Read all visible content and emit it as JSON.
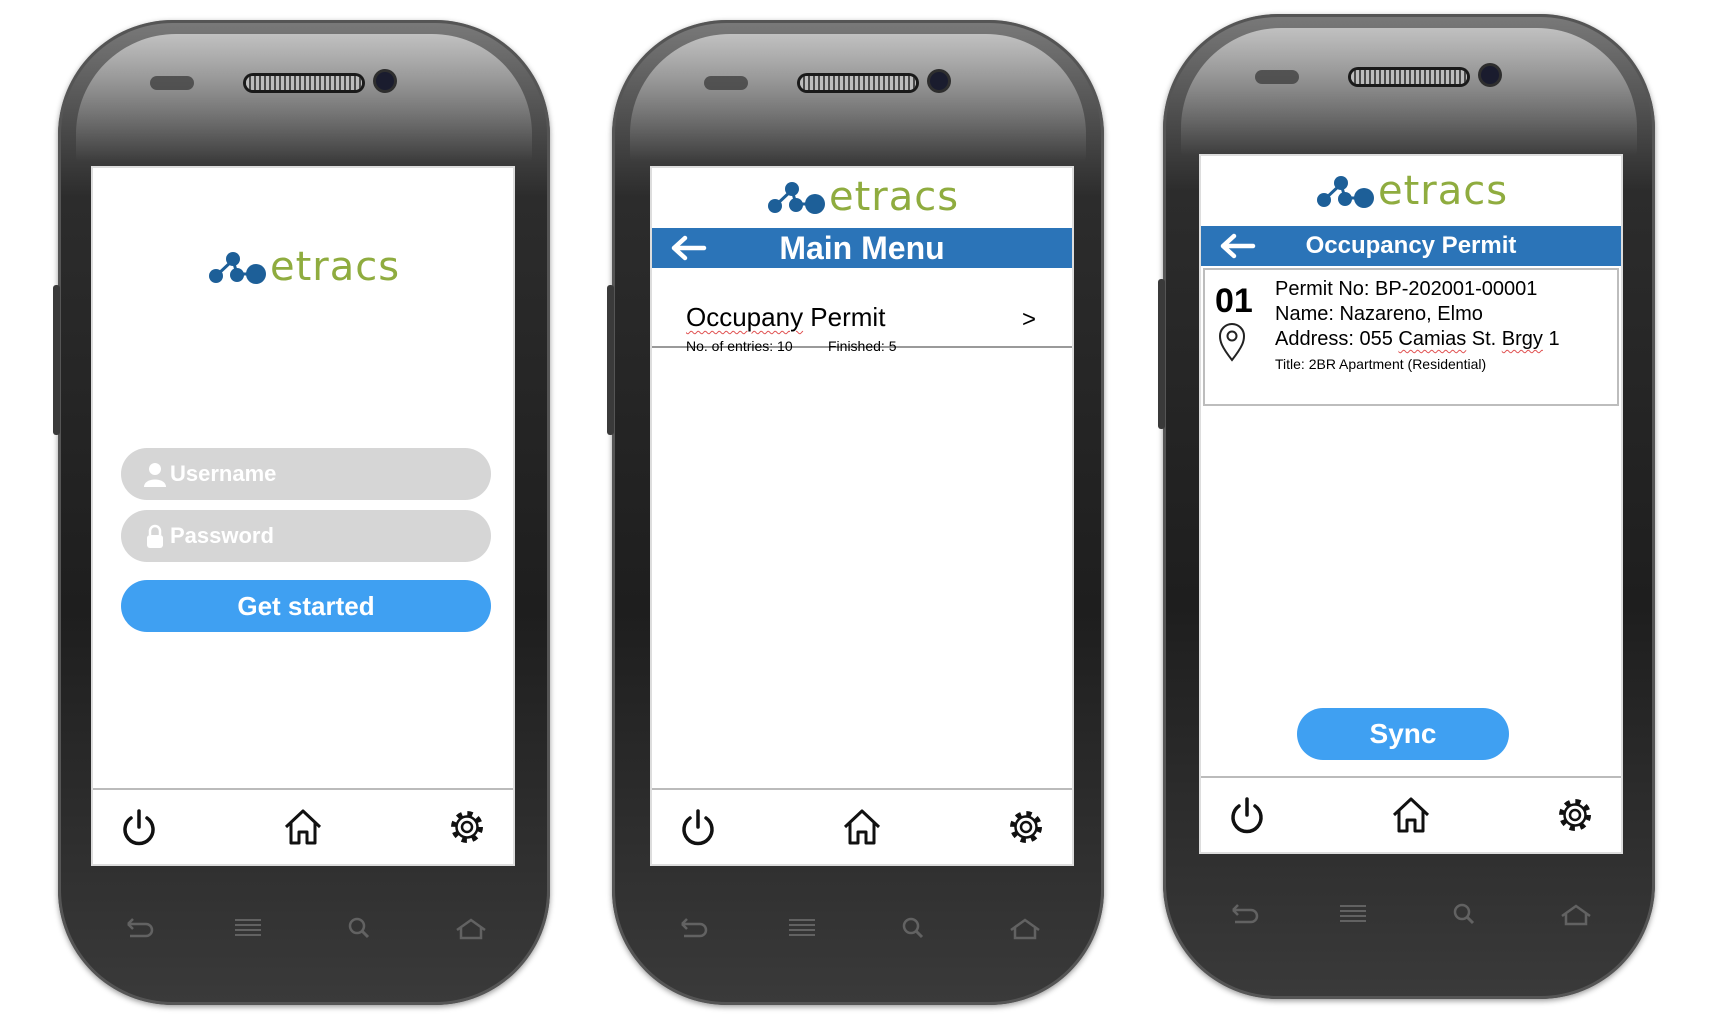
{
  "brand": {
    "logo_text": "etracs",
    "logo_color": "#8fac3f",
    "dot_color": "#1d5f98"
  },
  "colors": {
    "header_bar": "#2b74b8",
    "button": "#3fa0f2",
    "field_bg": "#d6d6d6"
  },
  "login_screen": {
    "username_placeholder": "Username",
    "password_placeholder": "Password",
    "submit_label": "Get started"
  },
  "main_menu_screen": {
    "title": "Main Menu",
    "items": [
      {
        "label_prefix": "Occupany",
        "label_suffix": " Permit",
        "entries_text": "No. of entries: 10",
        "finished_text": "Finished: 5",
        "chevron": ">"
      }
    ]
  },
  "permit_screen": {
    "title": "Occupancy Permit",
    "entries": [
      {
        "index": "01",
        "permit_no": "Permit No: BP-202001-00001",
        "name": "Name: Nazareno, Elmo",
        "address_prefix": "Address: 055 ",
        "address_street": "Camias",
        "address_mid": " St. ",
        "address_brgy": "Brgy",
        "address_suffix": " 1",
        "title_line": "Title: 2BR Apartment (Residential)"
      }
    ],
    "sync_label": "Sync"
  },
  "bottom_nav": {
    "icons": [
      "power-icon",
      "home-icon",
      "settings-icon"
    ]
  },
  "hardware_nav": {
    "icons": [
      "back-icon",
      "menu-icon",
      "search-icon",
      "home-icon"
    ]
  }
}
